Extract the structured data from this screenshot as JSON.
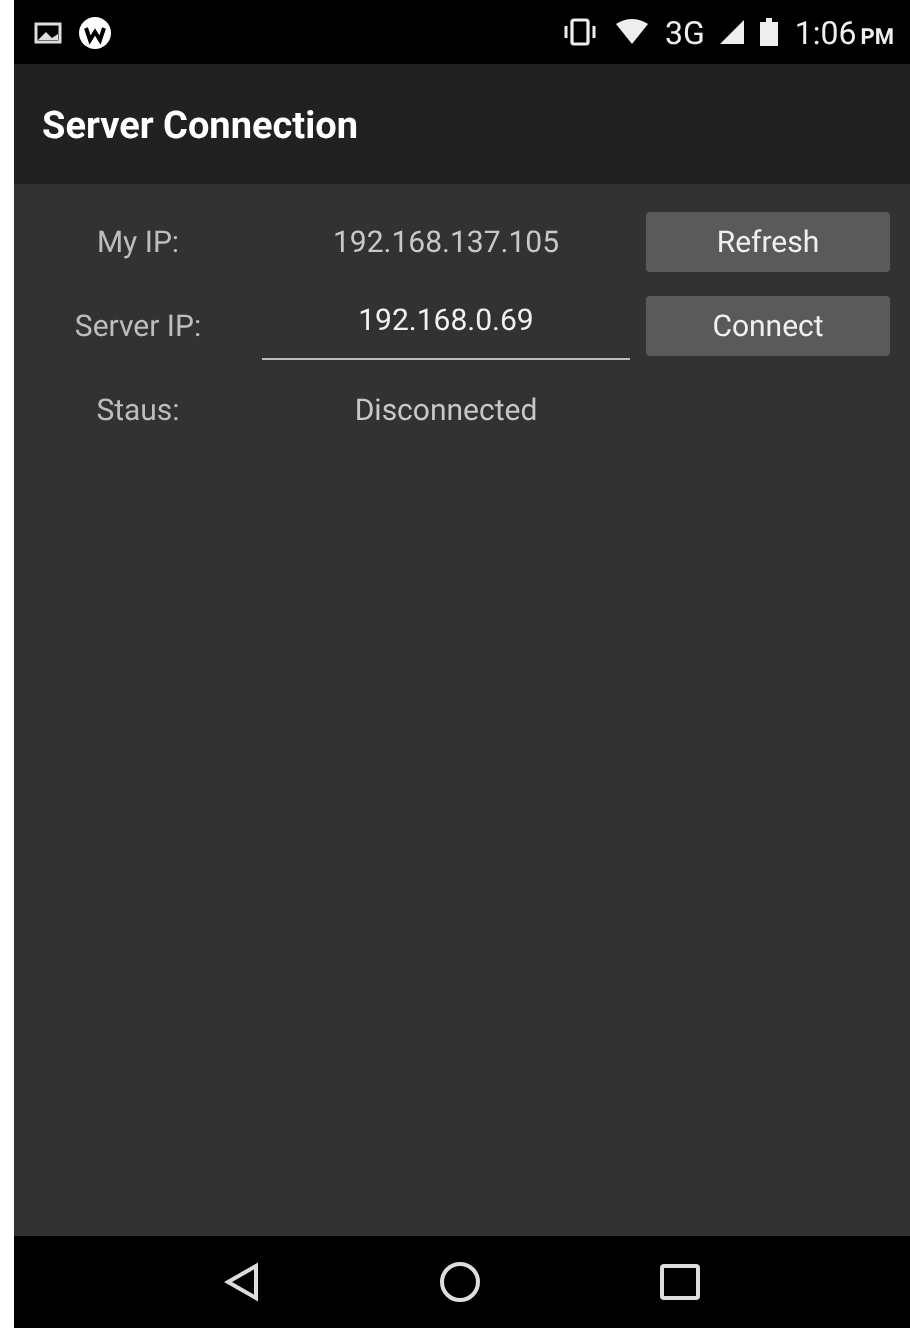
{
  "status_bar": {
    "time": "1:06",
    "time_suffix": "PM",
    "network": "3G"
  },
  "app_bar": {
    "title": "Server Connection"
  },
  "rows": [
    {
      "kind": "text",
      "label": "My IP:",
      "value": "192.168.137.105",
      "button": "Refresh"
    },
    {
      "kind": "input",
      "label": "Server IP:",
      "value": "192.168.0.69",
      "button": "Connect"
    },
    {
      "kind": "text",
      "label": "Staus:",
      "value": "Disconnected"
    }
  ]
}
